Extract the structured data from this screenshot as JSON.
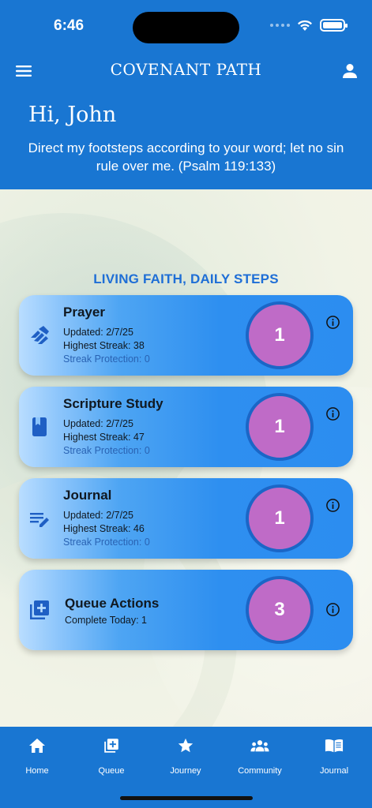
{
  "status_bar": {
    "time": "6:46"
  },
  "app_bar": {
    "title": "COVENANT PATH",
    "menu_icon": "menu-icon",
    "profile_icon": "person-icon"
  },
  "header": {
    "greeting": "Hi, John",
    "verse": "Direct my footsteps according to your word; let no sin rule over me. (Psalm 119:133)"
  },
  "main": {
    "section_title": "LIVING FAITH, DAILY STEPS",
    "cards": [
      {
        "icon": "praying-hands-icon",
        "title": "Prayer",
        "updated": "Updated: 2/7/25",
        "streak": "Highest Streak: 38",
        "protection": "Streak Protection: 0",
        "count": "1"
      },
      {
        "icon": "book-icon",
        "title": "Scripture Study",
        "updated": "Updated: 2/7/25",
        "streak": "Highest Streak: 47",
        "protection": "Streak Protection: 0",
        "count": "1"
      },
      {
        "icon": "edit-note-icon",
        "title": "Journal",
        "updated": "Updated: 2/7/25",
        "streak": "Highest Streak: 46",
        "protection": "Streak Protection: 0",
        "count": "1"
      }
    ],
    "queue_card": {
      "icon": "queue-add-icon",
      "title": "Queue Actions",
      "subtitle": "Complete Today: 1",
      "count": "3"
    }
  },
  "bottom_nav": {
    "items": [
      {
        "label": "Home",
        "icon": "home-icon"
      },
      {
        "label": "Queue",
        "icon": "queue-icon"
      },
      {
        "label": "Journey",
        "icon": "star-icon"
      },
      {
        "label": "Community",
        "icon": "groups-icon"
      },
      {
        "label": "Journal",
        "icon": "open-book-icon"
      }
    ]
  },
  "colors": {
    "primary": "#1976d2",
    "accent_text": "#1e6ed6",
    "count_circle": "#bf6bc7",
    "count_ring": "#1b66c7"
  }
}
